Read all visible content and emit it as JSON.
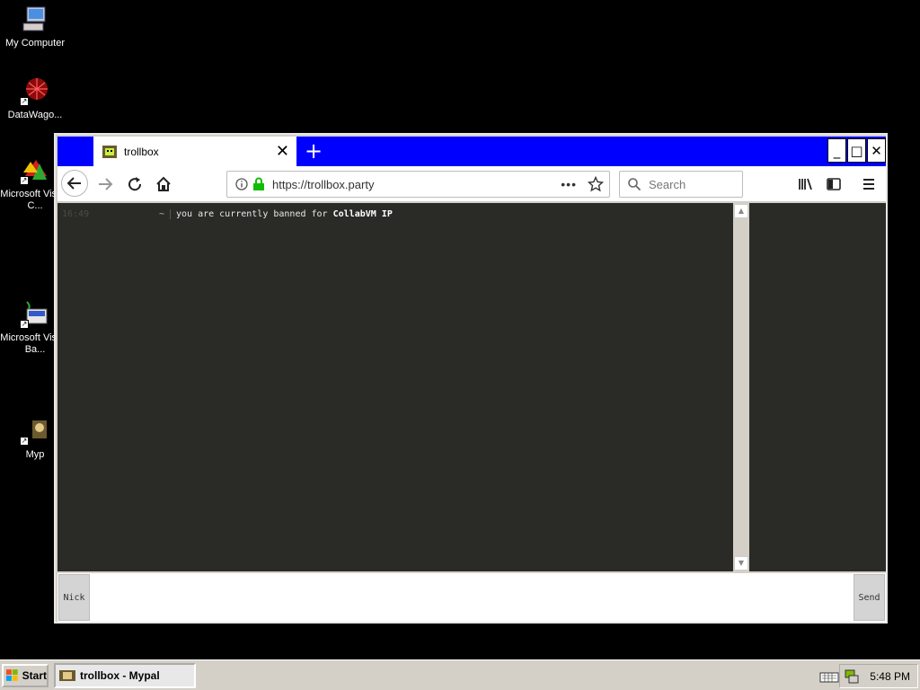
{
  "desktop": {
    "icons": [
      {
        "label": "My Computer"
      },
      {
        "label": "DataWago..."
      },
      {
        "label": "Microsoft Visual C..."
      },
      {
        "label": "Microsoft Visual Ba..."
      },
      {
        "label": "Myp"
      }
    ]
  },
  "browser": {
    "tab_title": "trollbox",
    "url": "https://trollbox.party",
    "search_placeholder": "Search",
    "window_controls": [
      "_",
      "□",
      "✕"
    ]
  },
  "chat": {
    "messages": [
      {
        "time": "16:49",
        "nick": "~",
        "text_prefix": "you are currently banned for ",
        "text_bold": "CollabVM IP"
      }
    ],
    "nick_button": "Nick",
    "send_button": "Send"
  },
  "taskbar": {
    "start_label": "Start",
    "task_label": "trollbox - Mypal",
    "clock": "5:48 PM"
  },
  "colors": {
    "titlebar": "#0000ff",
    "chat_background": "#2a2a26",
    "desktop": "#000000",
    "lock_green": "#12bc00"
  }
}
